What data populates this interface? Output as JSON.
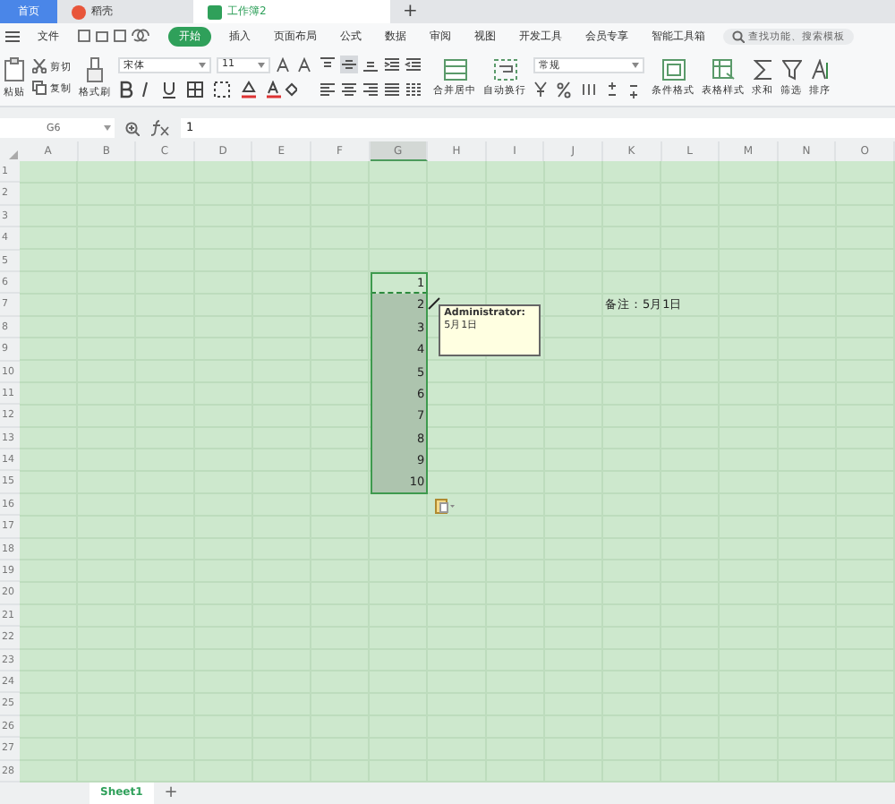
{
  "tabs": [
    {
      "label": "首页",
      "kind": "home",
      "selected": false
    },
    {
      "label": "稻壳",
      "kind": "app",
      "selected": false
    },
    {
      "label": "工作簿2",
      "kind": "doc",
      "selected": true
    }
  ],
  "new_tab": "+",
  "menu": {
    "file": "文件",
    "items": [
      {
        "label": "开始",
        "selected": true
      },
      {
        "label": "插入",
        "selected": false
      },
      {
        "label": "页面布局",
        "selected": false
      },
      {
        "label": "公式",
        "selected": false
      },
      {
        "label": "数据",
        "selected": false
      },
      {
        "label": "审阅",
        "selected": false
      },
      {
        "label": "视图",
        "selected": false
      },
      {
        "label": "开发工具",
        "selected": false
      },
      {
        "label": "会员专享",
        "selected": false
      },
      {
        "label": "智能工具箱",
        "selected": false
      }
    ]
  },
  "search": {
    "placeholder": "查找功能、搜索模板"
  },
  "ribbon": {
    "paste": "粘贴",
    "cut": "剪切",
    "copy": "复制",
    "format_painter": "格式刷",
    "font": "宋体",
    "font_size": "11",
    "merge": "合并居中",
    "wrap": "自动换行",
    "number_format": "常规",
    "conditional": "条件格式",
    "table_style": "表格样式",
    "sum": "求和",
    "filter": "筛选",
    "sort": "排序",
    "align": [
      {
        "kind": "top",
        "selected": false
      },
      {
        "kind": "middle",
        "selected": true
      },
      {
        "kind": "bottom",
        "selected": false
      },
      {
        "kind": "indent",
        "selected": false
      },
      {
        "kind": "outdent",
        "selected": false
      }
    ]
  },
  "formula_bar": {
    "name_box": "G6",
    "formula": "1"
  },
  "columns": [
    {
      "label": "A",
      "selected": false
    },
    {
      "label": "B",
      "selected": false
    },
    {
      "label": "C",
      "selected": false
    },
    {
      "label": "D",
      "selected": false
    },
    {
      "label": "E",
      "selected": false
    },
    {
      "label": "F",
      "selected": false
    },
    {
      "label": "G",
      "selected": true
    },
    {
      "label": "H",
      "selected": false
    },
    {
      "label": "I",
      "selected": false
    },
    {
      "label": "J",
      "selected": false
    },
    {
      "label": "K",
      "selected": false
    },
    {
      "label": "L",
      "selected": false
    },
    {
      "label": "M",
      "selected": false
    },
    {
      "label": "N",
      "selected": false
    },
    {
      "label": "O",
      "selected": false
    }
  ],
  "rows": [
    {
      "label": "1",
      "cells": []
    },
    {
      "label": "2",
      "cells": []
    },
    {
      "label": "3",
      "cells": []
    },
    {
      "label": "4",
      "cells": []
    },
    {
      "label": "5",
      "cells": []
    },
    {
      "label": "6",
      "cells": [
        {
          "kind": "empty"
        },
        {
          "kind": "empty"
        },
        {
          "kind": "empty"
        },
        {
          "kind": "empty"
        },
        {
          "kind": "empty"
        },
        {
          "kind": "empty"
        },
        {
          "value": "1",
          "kind": "number",
          "selected": true,
          "copied": true
        }
      ]
    },
    {
      "label": "7",
      "cells": [
        {
          "kind": "empty"
        },
        {
          "kind": "empty"
        },
        {
          "kind": "empty"
        },
        {
          "kind": "empty"
        },
        {
          "kind": "empty"
        },
        {
          "kind": "empty"
        },
        {
          "value": "2",
          "kind": "number",
          "selected": true,
          "copied": false,
          "comment": {
            "author": "Administrator:",
            "text": "5月1日"
          }
        },
        {
          "kind": "empty"
        },
        {
          "kind": "empty"
        },
        {
          "kind": "empty"
        },
        {
          "value": "备注：5月1日",
          "kind": "text",
          "selected": false,
          "copied": false
        }
      ]
    },
    {
      "label": "8",
      "cells": [
        {
          "kind": "empty"
        },
        {
          "kind": "empty"
        },
        {
          "kind": "empty"
        },
        {
          "kind": "empty"
        },
        {
          "kind": "empty"
        },
        {
          "kind": "empty"
        },
        {
          "value": "3",
          "kind": "number",
          "selected": true,
          "copied": false
        }
      ]
    },
    {
      "label": "9",
      "cells": [
        {
          "kind": "empty"
        },
        {
          "kind": "empty"
        },
        {
          "kind": "empty"
        },
        {
          "kind": "empty"
        },
        {
          "kind": "empty"
        },
        {
          "kind": "empty"
        },
        {
          "value": "4",
          "kind": "number",
          "selected": true,
          "copied": false
        }
      ]
    },
    {
      "label": "10",
      "cells": [
        {
          "kind": "empty"
        },
        {
          "kind": "empty"
        },
        {
          "kind": "empty"
        },
        {
          "kind": "empty"
        },
        {
          "kind": "empty"
        },
        {
          "kind": "empty"
        },
        {
          "value": "5",
          "kind": "number",
          "selected": true,
          "copied": false
        }
      ]
    },
    {
      "label": "11",
      "cells": [
        {
          "kind": "empty"
        },
        {
          "kind": "empty"
        },
        {
          "kind": "empty"
        },
        {
          "kind": "empty"
        },
        {
          "kind": "empty"
        },
        {
          "kind": "empty"
        },
        {
          "value": "6",
          "kind": "number",
          "selected": true,
          "copied": false
        }
      ]
    },
    {
      "label": "12",
      "cells": [
        {
          "kind": "empty"
        },
        {
          "kind": "empty"
        },
        {
          "kind": "empty"
        },
        {
          "kind": "empty"
        },
        {
          "kind": "empty"
        },
        {
          "kind": "empty"
        },
        {
          "value": "7",
          "kind": "number",
          "selected": true,
          "copied": false
        }
      ]
    },
    {
      "label": "13",
      "cells": [
        {
          "kind": "empty"
        },
        {
          "kind": "empty"
        },
        {
          "kind": "empty"
        },
        {
          "kind": "empty"
        },
        {
          "kind": "empty"
        },
        {
          "kind": "empty"
        },
        {
          "value": "8",
          "kind": "number",
          "selected": true,
          "copied": false
        }
      ]
    },
    {
      "label": "14",
      "cells": [
        {
          "kind": "empty"
        },
        {
          "kind": "empty"
        },
        {
          "kind": "empty"
        },
        {
          "kind": "empty"
        },
        {
          "kind": "empty"
        },
        {
          "kind": "empty"
        },
        {
          "value": "9",
          "kind": "number",
          "selected": true,
          "copied": false
        }
      ]
    },
    {
      "label": "15",
      "cells": [
        {
          "kind": "empty"
        },
        {
          "kind": "empty"
        },
        {
          "kind": "empty"
        },
        {
          "kind": "empty"
        },
        {
          "kind": "empty"
        },
        {
          "kind": "empty"
        },
        {
          "value": "10",
          "kind": "number",
          "selected": true,
          "copied": false
        }
      ]
    },
    {
      "label": "16",
      "cells": []
    },
    {
      "label": "17",
      "cells": []
    },
    {
      "label": "18",
      "cells": []
    },
    {
      "label": "19",
      "cells": []
    },
    {
      "label": "20",
      "cells": []
    },
    {
      "label": "21",
      "cells": []
    },
    {
      "label": "22",
      "cells": []
    },
    {
      "label": "23",
      "cells": []
    },
    {
      "label": "24",
      "cells": []
    },
    {
      "label": "25",
      "cells": []
    },
    {
      "label": "26",
      "cells": []
    },
    {
      "label": "27",
      "cells": []
    },
    {
      "label": "28",
      "cells": []
    }
  ],
  "sheets": [
    {
      "label": "Sheet1",
      "selected": true
    }
  ],
  "add_sheet": "+"
}
